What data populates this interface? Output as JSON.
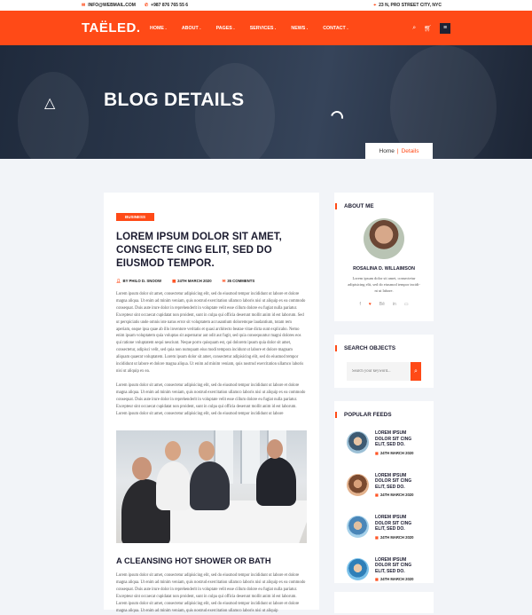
{
  "topbar": {
    "email": "INFO@WEBMAIL.COM",
    "phone": "+987 876 765 55 6",
    "address": "23 N, PRO STREET CITY, NYC"
  },
  "nav": {
    "logo": "TAËLED.",
    "menu": [
      "HOME .",
      "ABOUT .",
      "PAGES .",
      "SERVICES .",
      "NEWS .",
      "CONTACT ."
    ]
  },
  "hero": {
    "title": "BLOG DETAILS",
    "crumb_home": "Home",
    "crumb_sep": "|",
    "crumb_current": "Details"
  },
  "post": {
    "category": "BUSINESS",
    "title": "LOREM IPSUM DOLOR SIT AMET, CONSECTE CING ELIT, SED DO EIUSMOD TEMPOR.",
    "author": "BY PHILO D. SNOOW",
    "date": "24TH MARCH 2020",
    "comments": "35 COMMENTS",
    "para1": "Lorem ipsum dolor sit amet, consectetur adipisicing elit, sed do eiusmod tempor incididunt ut labore et dolore magna aliqua. Ut enim ad minim veniam, quis nostrud exercitation ullamco laboris nisi ut aliquip ex ea commodo consequat. Duis aute irure dolor in reprehenderit in voluptate velit esse cillum dolore eu fugiat nulla pariatur. Excepteur sint occaecat cupidatat non proident, sunt in culpa qui officia deserunt mollit anim id est laborum. Sed ut perspiciatis unde omnis iste natus error sit voluptatem accusantium doloremque laudantium, totam rem aperiam, eaque ipsa quae ab illo inventore veritatis et quasi architecto beatae vitae dicta sunt explicabo. Nemo enim ipsam voluptatem quia voluptas sit aspernatur aut odit aut fugit, sed quia consequuntur magni dolores eos qui ratione voluptatem sequi nesciunt. Neque porro quisquam est, qui dolorem ipsum quia dolor sit amet, consectetur, adipisci velit, sed quia non numquam eius modi tempora incidunt ut labore et dolore magnam aliquam quaerat voluptatem. Lorem ipsum dolor sit amet, consectetur adipisicing elit, sed do eiusmod tempor incididunt ut labore et dolore magna aliqua. Ut enim ad minim veniam, quis nostrud exercitation ullamco laboris nisi ut aliquip ex ea.",
    "para2": "Lorem ipsum dolor sit amet, consectetur adipisicing elit, sed do eiusmod tempor incididunt ut labore et dolore magna aliqua. Ut enim ad minim veniam, quis nostrud exercitation ullamco laboris nisi ut aliquip ex ea commodo consequat. Duis aute irure dolor in reprehenderit in voluptate velit esse cillum dolore eu fugiat nulla pariatur. Excepteur sint occaecat cupidatat non proident, sunt in culpa qui officia deserunt mollit anim id est laborum. Lorem ipsum dolor sit amet, consectetur adipisicing elit, sed do eiusmod tempor incididunt ut labore",
    "subheading": "A CLEANSING HOT SHOWER OR BATH",
    "para3": "Lorem ipsum dolor sit amet, consectetur adipisicing elit, sed do eiusmod tempor incididunt ut labore et dolore magna aliqua. Ut enim ad minim veniam, quis nostrud exercitation ullamco laboris nisi ut aliquip ex ea commodo consequat. Duis aute irure dolor in reprehenderit in voluptate velit esse cillum dolore eu fugiat nulla pariatur. Excepteur sint occaecat cupidatat non proident, sunt in culpa qui officia deserunt mollit anim id est laborum. Lorem ipsum dolor sit amet, consectetur adipisicing elit, sed do eiusmod tempor incididunt ut labore et dolore magna aliqua. Ut enim ad minim veniam, quis nostrud exercitation ullamco laboris nisi ut aliquip"
  },
  "sidebar": {
    "about": {
      "heading": "ABOUT ME",
      "name": "ROSALINA D. WILLAIMSON",
      "bio": "Lorem ipsum dolor sit amet, consectetur adipisicing elit, sed do eiusmod tempor incidi- nt ut labore."
    },
    "search": {
      "heading": "SEARCH OBJECTS",
      "placeholder": "Search your keyword..."
    },
    "feeds": {
      "heading": "POPULAR FEEDS",
      "items": [
        {
          "title": "LOREM IPSUM DOLOR SIT CING ELIT, SED DO.",
          "date": "24TH MARCH 2020"
        },
        {
          "title": "LOREM IPSUM DOLOR SIT CING ELIT, SED DO.",
          "date": "24TH MARCH 2020"
        },
        {
          "title": "LOREM IPSUM DOLOR SIT CING ELIT, SED DO.",
          "date": "24TH MARCH 2020"
        },
        {
          "title": "LOREM IPSUM DOLOR SIT CING ELIT, SED DO.",
          "date": "24TH MARCH 2020"
        }
      ]
    }
  },
  "colors": {
    "accent": "#ff4a17",
    "dark": "#1b1b2f"
  }
}
